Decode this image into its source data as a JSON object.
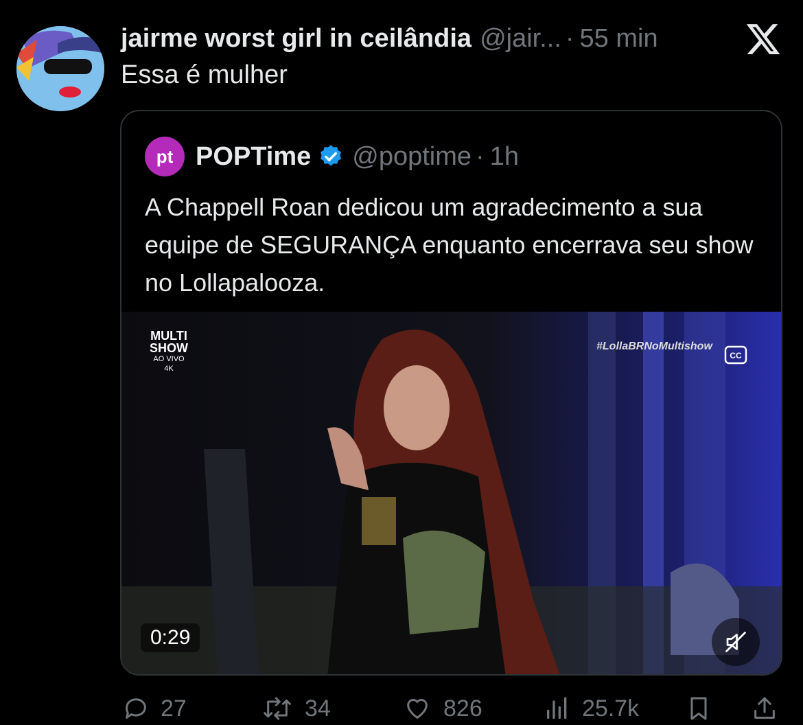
{
  "tweet": {
    "display_name": "jairme worst girl in ceilândia",
    "handle": "@jair...",
    "separator": "·",
    "time": "55 min",
    "text": "Essa é mulher"
  },
  "quote": {
    "avatar_text": "pt",
    "display_name": "POPTime",
    "handle": "@poptime",
    "separator": "·",
    "time": "1h",
    "text": "A Chappell Roan dedicou um agradecimento a sua equipe de SEGURANÇA enquanto encerrava seu show no Lollapalooza.",
    "video": {
      "broadcaster_line1": "MULTI",
      "broadcaster_line2": "SHOW",
      "broadcaster_live": "AO VIVO",
      "broadcaster_quality": "4K",
      "hashtag": "#LollaBRNoMultishow",
      "duration": "0:29"
    }
  },
  "actions": {
    "replies": "27",
    "reposts": "34",
    "likes": "826",
    "views": "25.7k"
  },
  "colors": {
    "background": "#000000",
    "text_primary": "#e7e9ea",
    "text_secondary": "#71767b",
    "verified_blue": "#1d9bf0",
    "poptime_purple": "#b32bb8"
  },
  "icons": [
    "x-logo-icon",
    "verified-badge-icon",
    "closed-captions-icon",
    "mute-icon",
    "reply-icon",
    "repost-icon",
    "like-icon",
    "views-icon",
    "bookmark-icon",
    "share-icon"
  ]
}
